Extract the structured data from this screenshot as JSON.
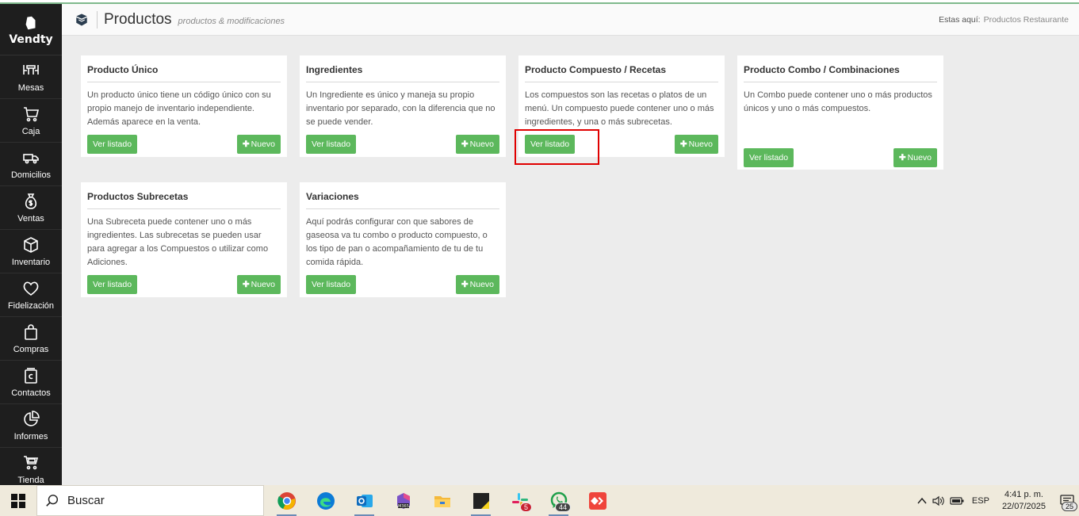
{
  "app": {
    "logo_text": "Vendty"
  },
  "sidebar": {
    "items": [
      {
        "label": "Mesas",
        "icon": "table-icon"
      },
      {
        "label": "Caja",
        "icon": "cart-icon"
      },
      {
        "label": "Domicilios",
        "icon": "truck-icon"
      },
      {
        "label": "Ventas",
        "icon": "money-bag-icon"
      },
      {
        "label": "Inventario",
        "icon": "box-icon"
      },
      {
        "label": "Fidelización",
        "icon": "heart-icon"
      },
      {
        "label": "Compras",
        "icon": "shopping-bag-icon"
      },
      {
        "label": "Contactos",
        "icon": "contacts-icon"
      },
      {
        "label": "Informes",
        "icon": "pie-chart-icon"
      },
      {
        "label": "Tienda",
        "icon": "store-icon"
      }
    ]
  },
  "header": {
    "title": "Productos",
    "subtitle": "productos & modificaciones",
    "breadcrumb_label": "Estas aquí:",
    "breadcrumb_link": "Productos Restaurante"
  },
  "cards": [
    {
      "title": "Producto Único",
      "description": "Un producto único tiene un código único con su propio manejo de inventario independiente. Además aparece en la venta.",
      "list_label": "Ver listado",
      "new_label": "Nuevo"
    },
    {
      "title": "Ingredientes",
      "description": "Un Ingrediente es único y maneja su propio inventario por separado, con la diferencia que no se puede vender.",
      "list_label": "Ver listado",
      "new_label": "Nuevo"
    },
    {
      "title": "Producto Compuesto / Recetas",
      "description": "Los compuestos son las recetas o platos de un menú. Un compuesto puede contener uno o más ingredientes, y una o más subrecetas.",
      "list_label": "Ver listado",
      "new_label": "Nuevo"
    },
    {
      "title": "Producto Combo / Combinaciones",
      "description": "Un Combo puede contener uno o más productos únicos y uno o más compuestos.",
      "list_label": "Ver listado",
      "new_label": "Nuevo"
    },
    {
      "title": "Productos Subrecetas",
      "description": "Una Subreceta puede contener uno o más ingredientes. Las subrecetas se pueden usar para agregar a los Compuestos o utilizar como Adiciones.",
      "list_label": "Ver listado",
      "new_label": "Nuevo"
    },
    {
      "title": "Variaciones",
      "description": "Aquí podrás configurar con que sabores de gaseosa va tu combo o producto compuesto, o los tipo de pan o acompañamiento de tu de tu comida rápida.",
      "list_label": "Ver listado",
      "new_label": "Nuevo"
    }
  ],
  "taskbar": {
    "search_text": "Buscar",
    "apps": [
      {
        "name": "chrome-icon",
        "badge": ""
      },
      {
        "name": "edge-icon",
        "badge": ""
      },
      {
        "name": "outlook-icon",
        "badge": ""
      },
      {
        "name": "m365-icon",
        "badge": ""
      },
      {
        "name": "file-explorer-icon",
        "badge": ""
      },
      {
        "name": "sticky-notes-icon",
        "badge": ""
      },
      {
        "name": "slack-icon",
        "badge": "5"
      },
      {
        "name": "whatsapp-icon",
        "badge": "44"
      },
      {
        "name": "anydesk-icon",
        "badge": ""
      }
    ],
    "language": "ESP",
    "time": "4:41 p. m.",
    "date": "22/07/2025",
    "notifications": "25"
  },
  "colors": {
    "sidebar": "#1e1e1e",
    "button_green": "#5cb85c",
    "highlight_red": "#e00000"
  }
}
